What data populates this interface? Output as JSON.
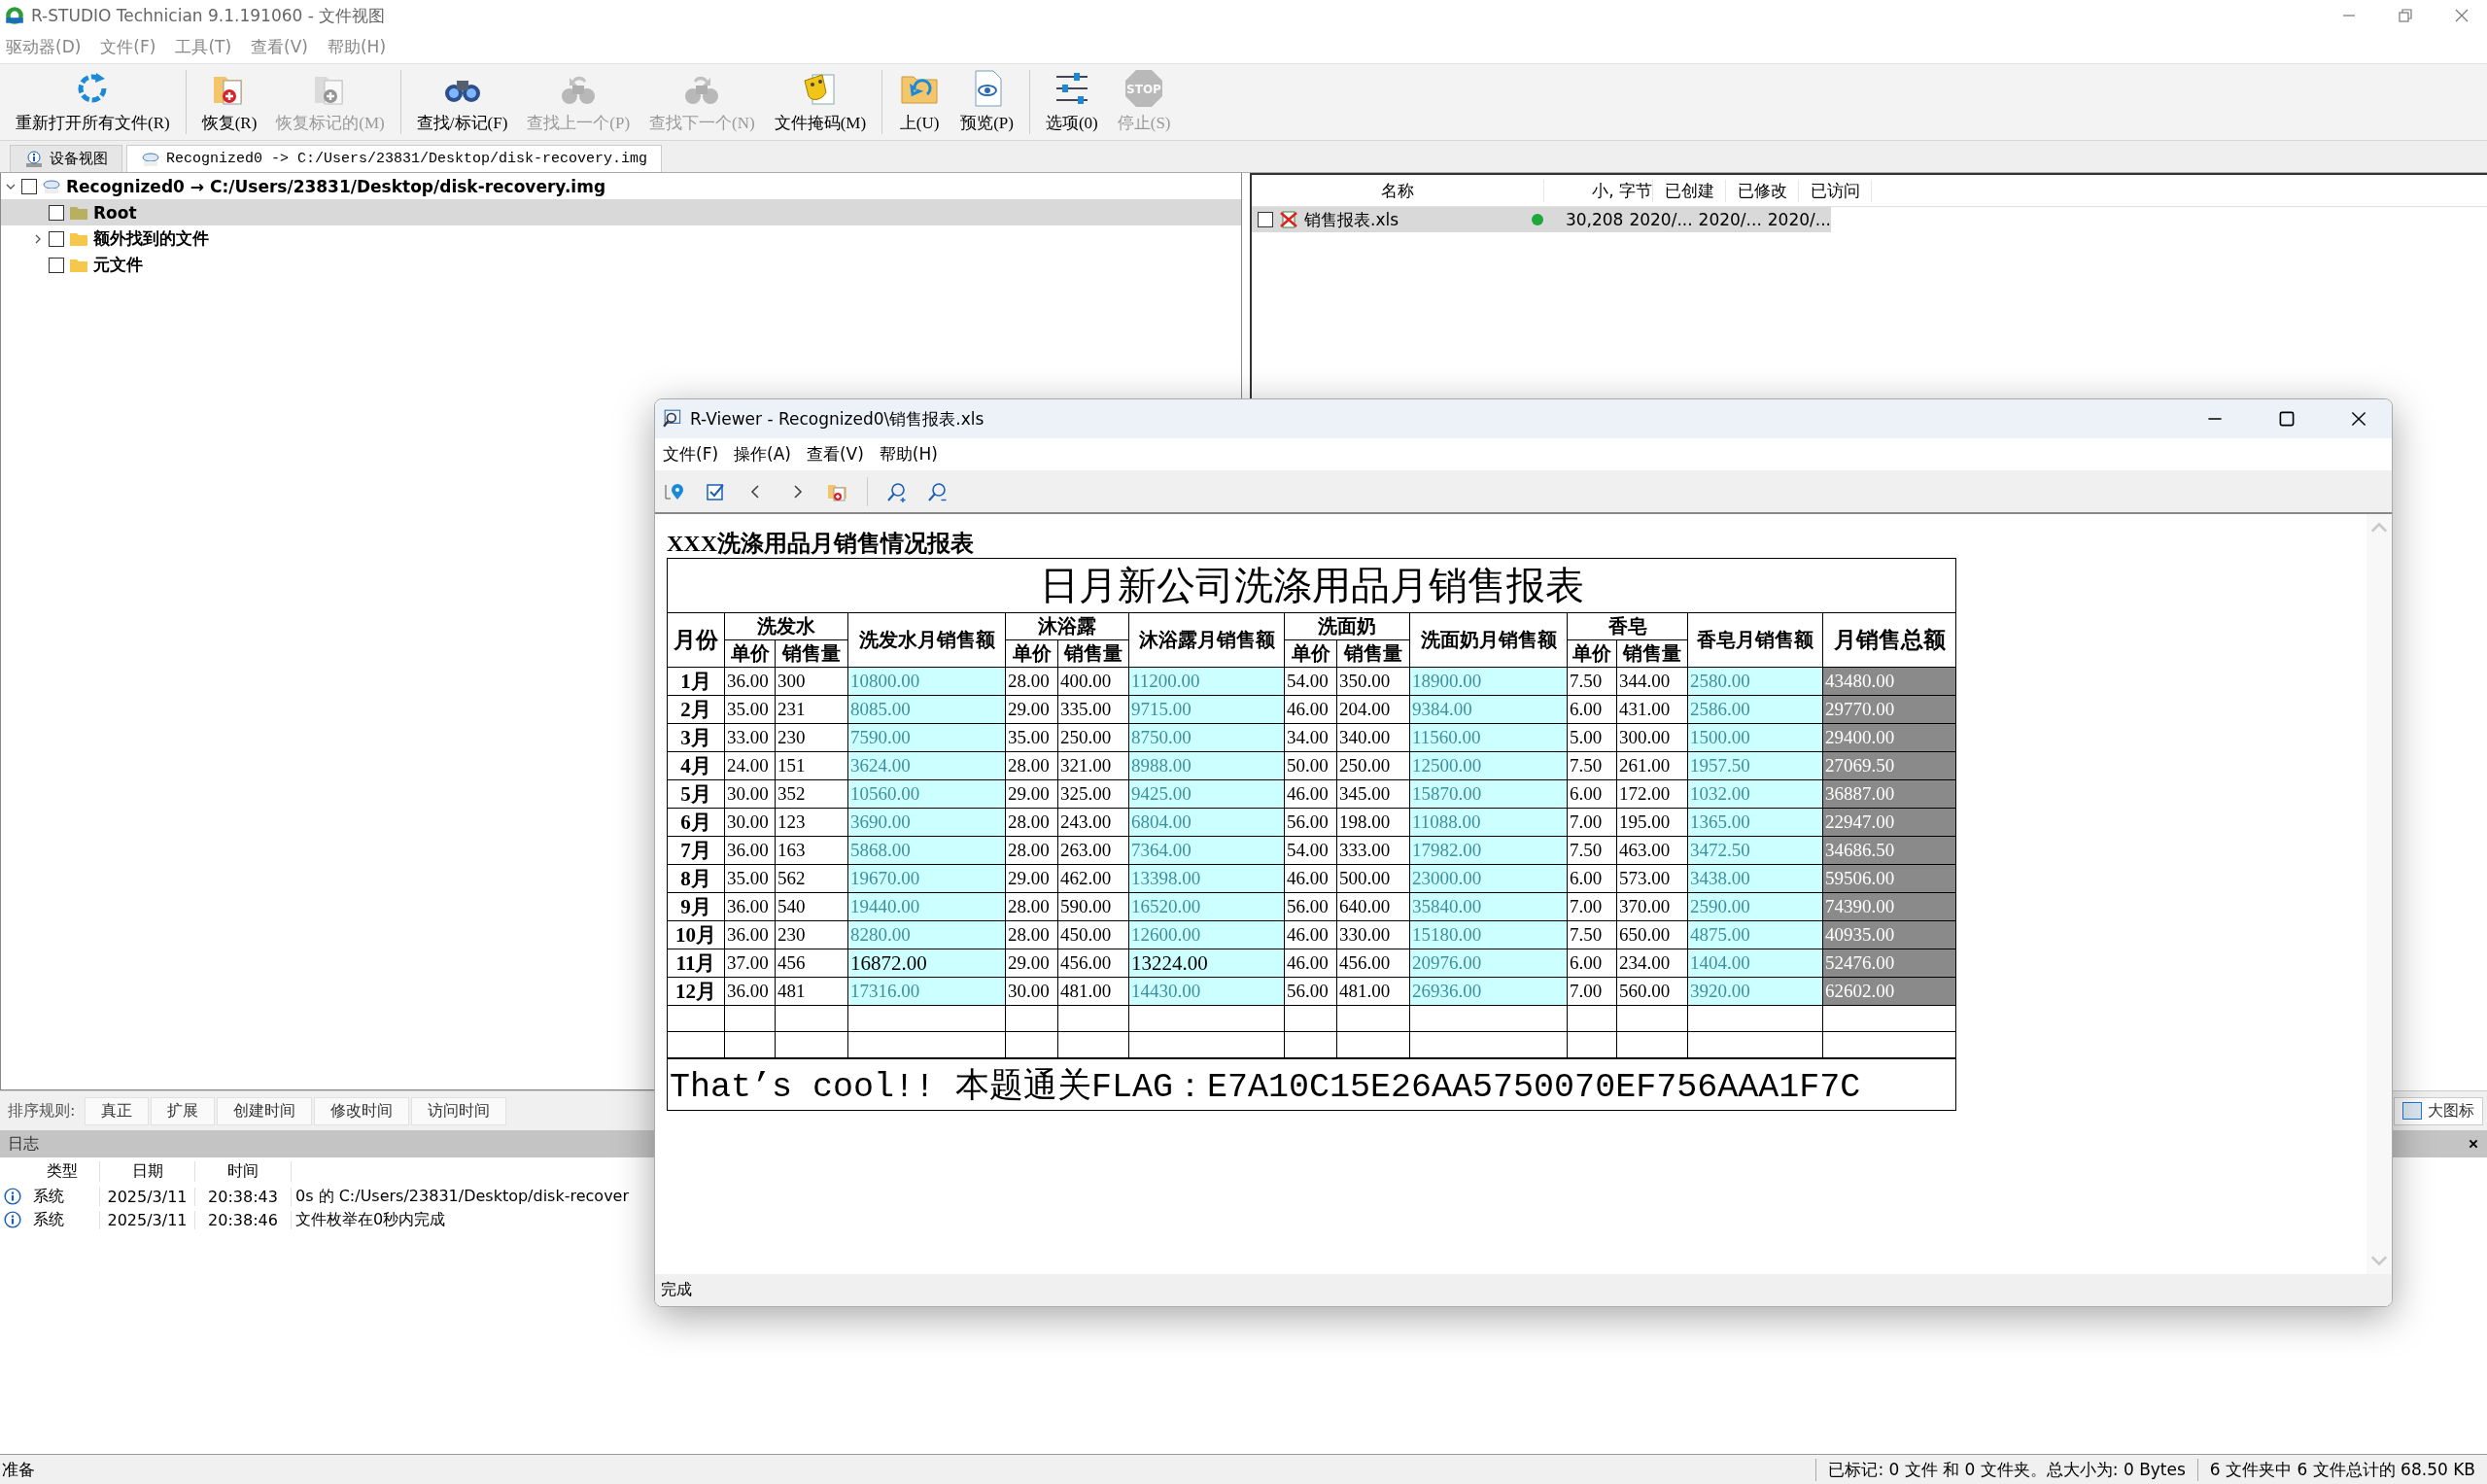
{
  "app": {
    "title": "R-STUDIO Technician 9.1.191060 - 文件视图",
    "menu": [
      "驱动器(D)",
      "文件(F)",
      "工具(T)",
      "查看(V)",
      "帮助(H)"
    ],
    "toolbar": [
      {
        "kind": "refresh",
        "label": "重新打开所有文件(R)",
        "disabled": false,
        "separator_before": false
      },
      {
        "kind": "recover",
        "label": "恢复(R)",
        "disabled": false,
        "separator_before": true
      },
      {
        "kind": "recover",
        "label": "恢复标记的(M)",
        "disabled": true,
        "separator_before": false
      },
      {
        "kind": "find",
        "label": "查找/标记(F)",
        "disabled": false,
        "separator_before": true
      },
      {
        "kind": "find-prev",
        "label": "查找上一个(P)",
        "disabled": true,
        "separator_before": false
      },
      {
        "kind": "find-next",
        "label": "查找下一个(N)",
        "disabled": true,
        "separator_before": false
      },
      {
        "kind": "mask",
        "label": "文件掩码(M)",
        "disabled": false,
        "separator_before": false
      },
      {
        "kind": "up",
        "label": "上(U)",
        "disabled": false,
        "separator_before": true
      },
      {
        "kind": "preview",
        "label": "预览(P)",
        "disabled": false,
        "separator_before": false
      },
      {
        "kind": "options",
        "label": "选项(0)",
        "disabled": false,
        "separator_before": true
      },
      {
        "kind": "stop",
        "label": "停止(S)",
        "disabled": true,
        "separator_before": false,
        "icon_text": "STOP"
      }
    ],
    "tabs": [
      {
        "kind": "device",
        "label": "设备视图",
        "selected": false
      },
      {
        "kind": "image",
        "label": "Recognized0 -> C:/Users/23831/Desktop/disk-recovery.img",
        "selected": true
      }
    ],
    "tree": [
      {
        "kind": "image",
        "label": "Recognized0 → C:/Users/23831/Desktop/disk-recovery.img",
        "checked": false,
        "selected": false,
        "expanded": true,
        "children": [
          {
            "kind": "folder",
            "label": "Root",
            "checked": false,
            "selected": true
          },
          {
            "kind": "folder",
            "label": "额外找到的文件",
            "checked": false,
            "selected": false,
            "expanded": false
          },
          {
            "kind": "folder",
            "label": "元文件",
            "checked": false,
            "selected": false
          }
        ]
      }
    ],
    "files": {
      "columns": [
        "名称",
        "小, 字节",
        "已创建",
        "已修改",
        "已访问"
      ],
      "rows": [
        {
          "name": "销售报表.xls",
          "checked": false,
          "selected": true,
          "size": "30,208",
          "created": "2020/...",
          "modified": "2020/...",
          "accessed": "2020/..."
        }
      ]
    },
    "sort_bar": {
      "label": "排序规则:",
      "buttons": [
        "真正",
        "扩展",
        "创建时间",
        "修改时间",
        "访问时间"
      ],
      "large_icons": {
        "label": "大图标",
        "checked": false
      }
    },
    "log": {
      "title": "日志",
      "columns": [
        "类型",
        "日期",
        "时间"
      ],
      "rows": [
        {
          "type": "系统",
          "date": "2025/3/11",
          "time": "20:38:43",
          "message": "0s 的 C:/Users/23831/Desktop/disk-recover"
        },
        {
          "type": "系统",
          "date": "2025/3/11",
          "time": "20:38:46",
          "message": "文件枚举在0秒内完成"
        }
      ]
    },
    "status_bar": [
      "准备",
      "已标记: 0 文件 和 0 文件夹。总大小为: 0 Bytes",
      "6 文件夹中 6 文件总计的 68.50 KB"
    ]
  },
  "viewer": {
    "title": "R-Viewer - Recognized0\\销售报表.xls",
    "menu": [
      "文件(F)",
      "操作(A)",
      "查看(V)",
      "帮助(H)"
    ],
    "status": "完成",
    "sheet": {
      "caption": "XXX洗涤用品月销售情况报表",
      "title": "日月新公司洗涤用品月销售报表",
      "month_header": "月份",
      "total_header": "月销售总额",
      "groups": [
        {
          "name": "洗发水",
          "sub": [
            "单价",
            "销售量"
          ],
          "amount": "洗发水月销售额"
        },
        {
          "name": "沐浴露",
          "sub": [
            "单价",
            "销售量"
          ],
          "amount": "沐浴露月销售额"
        },
        {
          "name": "洗面奶",
          "sub": [
            "单价",
            "销售量"
          ],
          "amount": "洗面奶月销售额"
        },
        {
          "name": "香皂",
          "sub": [
            "单价",
            "销售量"
          ],
          "amount": "香皂月销售额"
        }
      ],
      "rows": [
        {
          "month": "1月",
          "cells": [
            "36.00",
            "300",
            "10800.00",
            "28.00",
            "400.00",
            "11200.00",
            "54.00",
            "350.00",
            "18900.00",
            "7.50",
            "344.00",
            "2580.00",
            "43480.00"
          ],
          "faded": [
            true,
            true,
            true,
            true
          ]
        },
        {
          "month": "2月",
          "cells": [
            "35.00",
            "231",
            "8085.00",
            "29.00",
            "335.00",
            "9715.00",
            "46.00",
            "204.00",
            "9384.00",
            "6.00",
            "431.00",
            "2586.00",
            "29770.00"
          ],
          "faded": [
            true,
            true,
            true,
            true
          ]
        },
        {
          "month": "3月",
          "cells": [
            "33.00",
            "230",
            "7590.00",
            "35.00",
            "250.00",
            "8750.00",
            "34.00",
            "340.00",
            "11560.00",
            "5.00",
            "300.00",
            "1500.00",
            "29400.00"
          ],
          "faded": [
            true,
            true,
            true,
            true
          ]
        },
        {
          "month": "4月",
          "cells": [
            "24.00",
            "151",
            "3624.00",
            "28.00",
            "321.00",
            "8988.00",
            "50.00",
            "250.00",
            "12500.00",
            "7.50",
            "261.00",
            "1957.50",
            "27069.50"
          ],
          "faded": [
            true,
            true,
            true,
            true
          ]
        },
        {
          "month": "5月",
          "cells": [
            "30.00",
            "352",
            "10560.00",
            "29.00",
            "325.00",
            "9425.00",
            "46.00",
            "345.00",
            "15870.00",
            "6.00",
            "172.00",
            "1032.00",
            "36887.00"
          ],
          "faded": [
            true,
            true,
            true,
            true
          ]
        },
        {
          "month": "6月",
          "cells": [
            "30.00",
            "123",
            "3690.00",
            "28.00",
            "243.00",
            "6804.00",
            "56.00",
            "198.00",
            "11088.00",
            "7.00",
            "195.00",
            "1365.00",
            "22947.00"
          ],
          "faded": [
            true,
            true,
            true,
            true
          ]
        },
        {
          "month": "7月",
          "cells": [
            "36.00",
            "163",
            "5868.00",
            "28.00",
            "263.00",
            "7364.00",
            "54.00",
            "333.00",
            "17982.00",
            "7.50",
            "463.00",
            "3472.50",
            "34686.50"
          ],
          "faded": [
            true,
            true,
            true,
            true
          ]
        },
        {
          "month": "8月",
          "cells": [
            "35.00",
            "562",
            "19670.00",
            "29.00",
            "462.00",
            "13398.00",
            "46.00",
            "500.00",
            "23000.00",
            "6.00",
            "573.00",
            "3438.00",
            "59506.00"
          ],
          "faded": [
            true,
            true,
            true,
            true
          ]
        },
        {
          "month": "9月",
          "cells": [
            "36.00",
            "540",
            "19440.00",
            "28.00",
            "590.00",
            "16520.00",
            "56.00",
            "640.00",
            "35840.00",
            "7.00",
            "370.00",
            "2590.00",
            "74390.00"
          ],
          "faded": [
            true,
            true,
            true,
            true
          ]
        },
        {
          "month": "10月",
          "cells": [
            "36.00",
            "230",
            "8280.00",
            "28.00",
            "450.00",
            "12600.00",
            "46.00",
            "330.00",
            "15180.00",
            "7.50",
            "650.00",
            "4875.00",
            "40935.00"
          ],
          "faded": [
            true,
            true,
            true,
            true
          ]
        },
        {
          "month": "11月",
          "cells": [
            "37.00",
            "456",
            "16872.00",
            "29.00",
            "456.00",
            "13224.00",
            "46.00",
            "456.00",
            "20976.00",
            "6.00",
            "234.00",
            "1404.00",
            "52476.00"
          ],
          "faded": [
            false,
            false,
            true,
            true
          ]
        },
        {
          "month": "12月",
          "cells": [
            "36.00",
            "481",
            "17316.00",
            "30.00",
            "481.00",
            "14430.00",
            "56.00",
            "481.00",
            "26936.00",
            "7.00",
            "560.00",
            "3920.00",
            "62602.00"
          ],
          "faded": [
            true,
            true,
            true,
            true
          ]
        }
      ],
      "flag": "That’s cool!! 本题通关FLAG：E7A10C15E26AA5750070EF756AAA1F7C"
    }
  }
}
